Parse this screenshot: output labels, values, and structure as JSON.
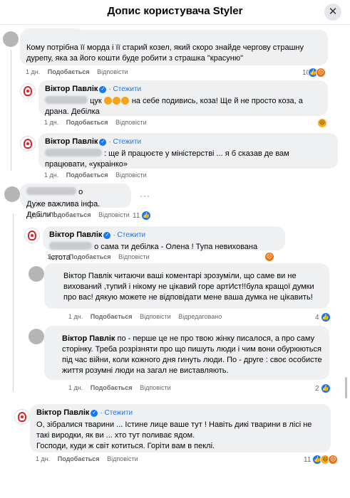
{
  "header": {
    "title": "Допис користувача Styler",
    "close_glyph": "✕"
  },
  "author": "Віктор Павлік",
  "badge_glyph": "✓",
  "follow_label": "Стежити",
  "actions": {
    "like": "Подобається",
    "reply": "Відповісти",
    "edited": "Відредаговано"
  },
  "comments": [
    {
      "text": "Кому потрібна її морда і її старий козел, який скоро знайде чергову страшну дурепу, яка за його кошти буде робити з страшка \"красуню\"",
      "time": "1 дн.",
      "reactions": "10"
    },
    {
      "text_suffix": "цук",
      "text": "на себе подивись, коза! Ще й не просто коза, а драна. Дебілка",
      "time": "1 дн."
    },
    {
      "text": ": ще й працюєте у міністерстві ... я б сказав де вам працювати, «украінко»",
      "time": "1 дн."
    },
    {
      "text_prefix": "о",
      "text": "Дуже важлива інфа. Дебіли !",
      "time": "1 дн.",
      "reactions": "11"
    },
    {
      "text": "о сама ти дебілка - Олена ! Тупа невихована істота",
      "time": "1 дн."
    },
    {
      "text": "Віктор Павлік читаючи ваші коментарі зрозуміли, що саме ви не вихований ,тупий і нікому не цікавий горе артИст!!була кращої думки про вас! дякую можете не відповідати мене ваша думка не цікавить!",
      "time": "1 дн.",
      "reactions": "4"
    },
    {
      "text": "по - перше це не про твою жінку писалося, а про саму сторінку. Треба розрізняти про що пишуть люди і чим вони обурюються під час війни, коли кожного дня гинуть люди. По - друге : своє особисте життя розумні люди на загал не виставляють.",
      "time": "1 дн.",
      "reactions": "2"
    },
    {
      "text": "О, зібралися тварини ... Істине лице ваше тут ! Навіть дикі тварини в лісі не такі виродки, як ви ... хто тут поливає ядом.\nГосподи, куди ж світ котиться. Горіти вам в пеклі.",
      "time": "1 дн.",
      "reactions": "11"
    }
  ],
  "more_glyph": "···"
}
